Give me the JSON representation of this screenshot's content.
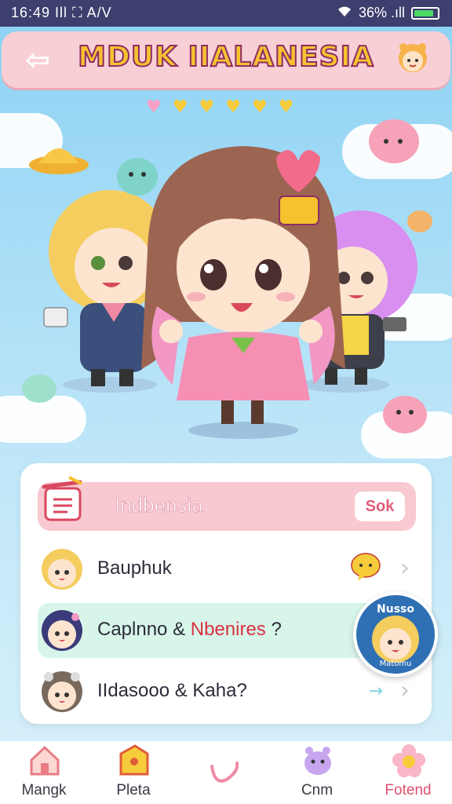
{
  "status_bar": {
    "time_and_info": "16:49 Ill ⛶ A/V",
    "network": "36% .ıll",
    "battery_color": "#4cd964"
  },
  "header": {
    "title": "MDUK IIALANESIA",
    "back_icon": "back-arrow-icon",
    "mascot_icon": "mascot-icon"
  },
  "hearts": [
    "♥",
    "♥",
    "♥",
    "♥",
    "♥",
    "♥"
  ],
  "panel": {
    "search": {
      "text": "Indbensia",
      "button": "Sok"
    },
    "rows": [
      {
        "label": "Bauphuk",
        "highlighted": false
      },
      {
        "label_a": "Caplnno & ",
        "label_b": "Nbenires",
        "label_c": " ?",
        "highlighted": true
      },
      {
        "label": "IIdasooo & Kaha?",
        "highlighted": false
      }
    ]
  },
  "badge": {
    "text": "Nusso",
    "sub": "Matomu"
  },
  "nav": [
    {
      "label": "Mangk",
      "icon": "home-icon"
    },
    {
      "label": "Pleta",
      "icon": "tag-icon"
    },
    {
      "label": "",
      "icon": "link-icon"
    },
    {
      "label": "Cnm",
      "icon": "creature-icon"
    },
    {
      "label": "Fotend",
      "icon": "flower-icon"
    }
  ],
  "colors": {
    "header_bg": "#f9cfd6",
    "title_fill": "#f6c230",
    "title_stroke": "#8c2e62",
    "row_highlight": "#d8f5ea"
  }
}
